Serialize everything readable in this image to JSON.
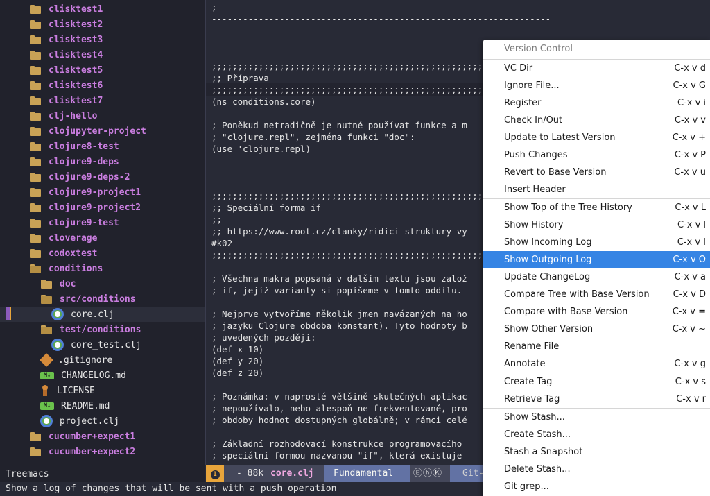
{
  "sidebar": {
    "items": [
      {
        "label": "clisktest1",
        "type": "folder",
        "indent": 0
      },
      {
        "label": "clisktest2",
        "type": "folder",
        "indent": 0
      },
      {
        "label": "clisktest3",
        "type": "folder",
        "indent": 0
      },
      {
        "label": "clisktest4",
        "type": "folder",
        "indent": 0
      },
      {
        "label": "clisktest5",
        "type": "folder",
        "indent": 0
      },
      {
        "label": "clisktest6",
        "type": "folder",
        "indent": 0
      },
      {
        "label": "clisktest7",
        "type": "folder",
        "indent": 0
      },
      {
        "label": "clj-hello",
        "type": "folder",
        "indent": 0
      },
      {
        "label": "clojupyter-project",
        "type": "folder",
        "indent": 0
      },
      {
        "label": "clojure8-test",
        "type": "folder",
        "indent": 0
      },
      {
        "label": "clojure9-deps",
        "type": "folder",
        "indent": 0
      },
      {
        "label": "clojure9-deps-2",
        "type": "folder",
        "indent": 0
      },
      {
        "label": "clojure9-project1",
        "type": "folder",
        "indent": 0
      },
      {
        "label": "clojure9-project2",
        "type": "folder",
        "indent": 0
      },
      {
        "label": "clojure9-test",
        "type": "folder",
        "indent": 0
      },
      {
        "label": "cloverage",
        "type": "folder",
        "indent": 0
      },
      {
        "label": "codoxtest",
        "type": "folder",
        "indent": 0
      },
      {
        "label": "conditions",
        "type": "folder-open",
        "indent": 0
      },
      {
        "label": "doc",
        "type": "folder",
        "indent": 1
      },
      {
        "label": "src/conditions",
        "type": "folder-open",
        "indent": 1
      },
      {
        "label": "core.clj",
        "type": "clj",
        "indent": 2
      },
      {
        "label": "test/conditions",
        "type": "folder-open",
        "indent": 1
      },
      {
        "label": "core_test.clj",
        "type": "clj",
        "indent": 2
      },
      {
        "label": ".gitignore",
        "type": "git",
        "indent": 1
      },
      {
        "label": "CHANGELOG.md",
        "type": "md",
        "indent": 1
      },
      {
        "label": "LICENSE",
        "type": "license",
        "indent": 1
      },
      {
        "label": "README.md",
        "type": "md",
        "indent": 1
      },
      {
        "label": "project.clj",
        "type": "clj",
        "indent": 1
      },
      {
        "label": "cucumber+expect1",
        "type": "folder",
        "indent": 0
      },
      {
        "label": "cucumber+expect2",
        "type": "folder",
        "indent": 0
      }
    ],
    "md_badge": "M↓"
  },
  "editor": {
    "lines": [
      "; ----------------------------------------------------------------------------------------------------",
      "-----------------------------------------------------------------",
      "",
      "",
      "",
      ";;;;;;;;;;;;;;;;;;;;;;;;;;;;;;;;;;;;;;;;;;;;;;;;;;;;;;",
      ";; Příprava",
      ";;;;;;;;;;;;;;;;;;;;;;;;;;;;;;;;;;;;;;;;;;;;;;;;;;;;;;",
      "(ns conditions.core)",
      "",
      "; Poněkud netradičně je nutné používat funkce a m",
      "; \"clojure.repl\", zejména funkci \"doc\":",
      "(use 'clojure.repl)",
      "",
      "",
      "",
      ";;;;;;;;;;;;;;;;;;;;;;;;;;;;;;;;;;;;;;;;;;;;;;;;;;;;;;",
      ";; Speciální forma if",
      ";;",
      ";; https://www.root.cz/clanky/ridici-struktury-vy",
      "#k02",
      ";;;;;;;;;;;;;;;;;;;;;;;;;;;;;;;;;;;;;;;;;;;;;;;;;;;;;;",
      "",
      "; Všechna makra popsaná v dalším textu jsou založ",
      "; if, jejíž varianty si popíšeme v tomto oddílu.",
      "",
      "; Nejprve vytvoříme několik jmen navázaných na ho",
      "; jazyku Clojure obdoba konstant). Tyto hodnoty b",
      "; uvedených později:",
      "(def x 10)",
      "(def y 20)",
      "(def z 20)",
      "",
      "; Poznámka: v naprosté většině skutečných aplikac",
      "; nepoužívalo, nebo alespoň ne frekventovaně, pro",
      "; obdoby hodnot dostupných globálně; v rámci celé",
      "",
      "; Základní rozhodovací konstrukce programovacího",
      "; speciální formou nazvanou \"if\", která existuje"
    ]
  },
  "modeline": {
    "treemacs_label": "Treemacs",
    "window_number": "1",
    "size": "- 88k",
    "filename": "core.clj",
    "major_mode": "Fundamental",
    "minor_modes": "ⒺⓗⓀ",
    "vc": "Git-"
  },
  "echo": {
    "message": "Show a log of changes that will be sent with a push operation"
  },
  "vc_menu": {
    "title": "Version Control",
    "items": [
      {
        "label": "VC Dir",
        "key": "C-x v d"
      },
      {
        "label": "Ignore File...",
        "key": "C-x v G"
      },
      {
        "label": "Register",
        "key": "C-x v i"
      },
      {
        "label": "Check In/Out",
        "key": "C-x v v"
      },
      {
        "label": "Update to Latest Version",
        "key": "C-x v +"
      },
      {
        "label": "Push Changes",
        "key": "C-x v P"
      },
      {
        "label": "Revert to Base Version",
        "key": "C-x v u"
      },
      {
        "label": "Insert Header",
        "key": ""
      },
      {
        "label": "Show Top of the Tree History",
        "key": "C-x v L",
        "sep_before": true
      },
      {
        "label": "Show History",
        "key": "C-x v l"
      },
      {
        "label": "Show Incoming Log",
        "key": "C-x v I"
      },
      {
        "label": "Show Outgoing Log",
        "key": "C-x v O",
        "active": true
      },
      {
        "label": "Update ChangeLog",
        "key": "C-x v a"
      },
      {
        "label": "Compare Tree with Base Version",
        "key": "C-x v D"
      },
      {
        "label": "Compare with Base Version",
        "key": "C-x v ="
      },
      {
        "label": "Show Other Version",
        "key": "C-x v ~"
      },
      {
        "label": "Rename File",
        "key": ""
      },
      {
        "label": "Annotate",
        "key": "C-x v g"
      },
      {
        "label": "Create Tag",
        "key": "C-x v s",
        "sep_before": true
      },
      {
        "label": "Retrieve Tag",
        "key": "C-x v r"
      },
      {
        "label": "Show Stash...",
        "key": "",
        "sep_before": true
      },
      {
        "label": "Create Stash...",
        "key": ""
      },
      {
        "label": "Stash a Snapshot",
        "key": ""
      },
      {
        "label": "Delete Stash...",
        "key": ""
      },
      {
        "label": "Git grep...",
        "key": ""
      }
    ]
  },
  "colors": {
    "folder": "#c9a256",
    "folder_label": "#ca7ee0",
    "cursor": "#e8a53b",
    "menu_highlight": "#3584e4"
  }
}
